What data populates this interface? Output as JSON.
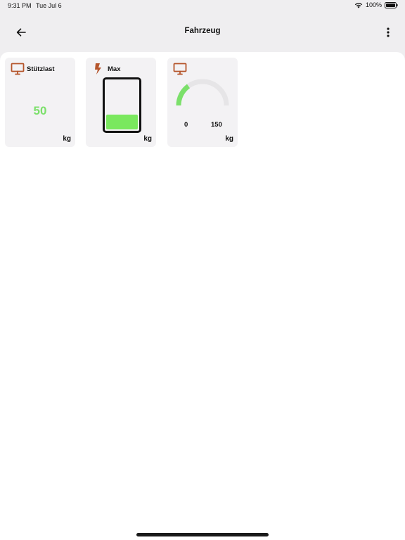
{
  "status_bar": {
    "time": "9:31 PM",
    "date": "Tue Jul 6",
    "battery_text": "100%"
  },
  "nav": {
    "title": "Fahrzeug",
    "back_icon": "arrow-left-icon",
    "more_icon": "more-vertical-icon"
  },
  "tiles": [
    {
      "icon": "monitor-icon",
      "label": "Stützlast",
      "value": "50",
      "unit": "kg",
      "value_color": "#7be06a"
    },
    {
      "icon": "lightning-icon",
      "label": "Max",
      "unit": "kg",
      "fill_fraction": 0.3,
      "fill_color": "#7ae85e"
    },
    {
      "icon": "monitor-icon",
      "label": "",
      "gauge_min": "0",
      "gauge_max": "150",
      "unit": "kg",
      "gauge_fraction": 0.3,
      "gauge_color": "#7be06a"
    }
  ],
  "colors": {
    "icon_accent": "#b5552b",
    "gauge_track": "#e6e5e7"
  }
}
